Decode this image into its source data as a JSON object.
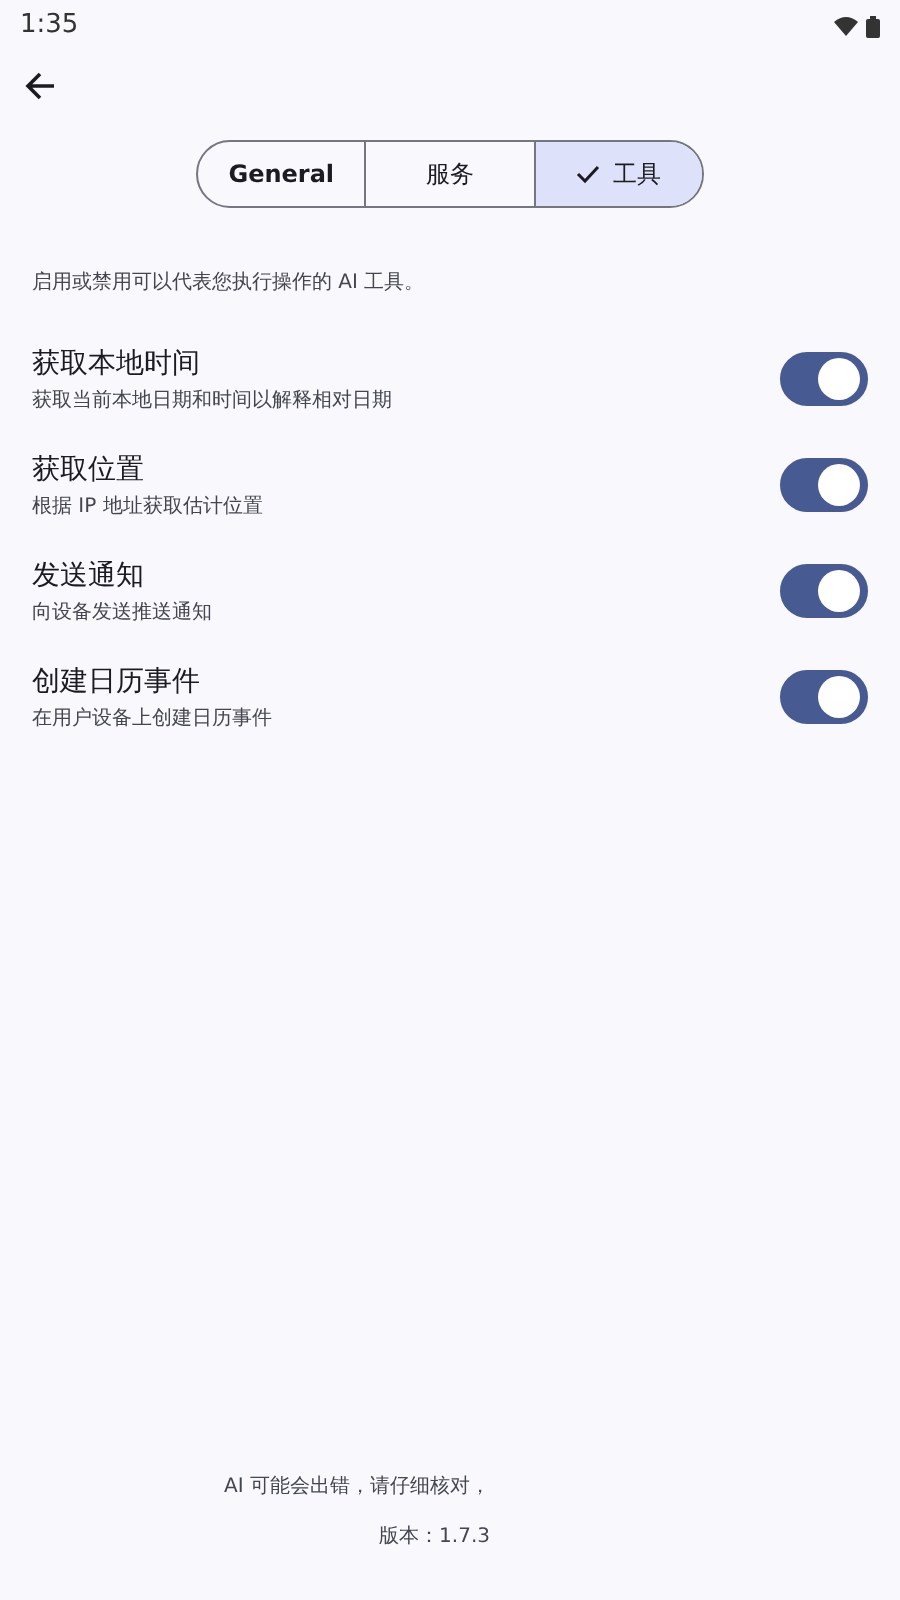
{
  "status_bar": {
    "time": "1:35"
  },
  "tabs": [
    {
      "label": "General",
      "selected": false
    },
    {
      "label": "服务",
      "selected": false
    },
    {
      "label": "工具",
      "selected": true
    }
  ],
  "description": "启用或禁用可以代表您执行操作的 AI 工具。",
  "tools": [
    {
      "title": "获取本地时间",
      "subtitle": "获取当前本地日期和时间以解释相对日期",
      "on": true
    },
    {
      "title": "获取位置",
      "subtitle": "根据 IP 地址获取估计位置",
      "on": true
    },
    {
      "title": "发送通知",
      "subtitle": "向设备发送推送通知",
      "on": true
    },
    {
      "title": "创建日历事件",
      "subtitle": "在用户设备上创建日历事件",
      "on": true
    }
  ],
  "footer": [
    "AI 可能会出错，请仔细核对，",
    "版本：1.7.3"
  ]
}
